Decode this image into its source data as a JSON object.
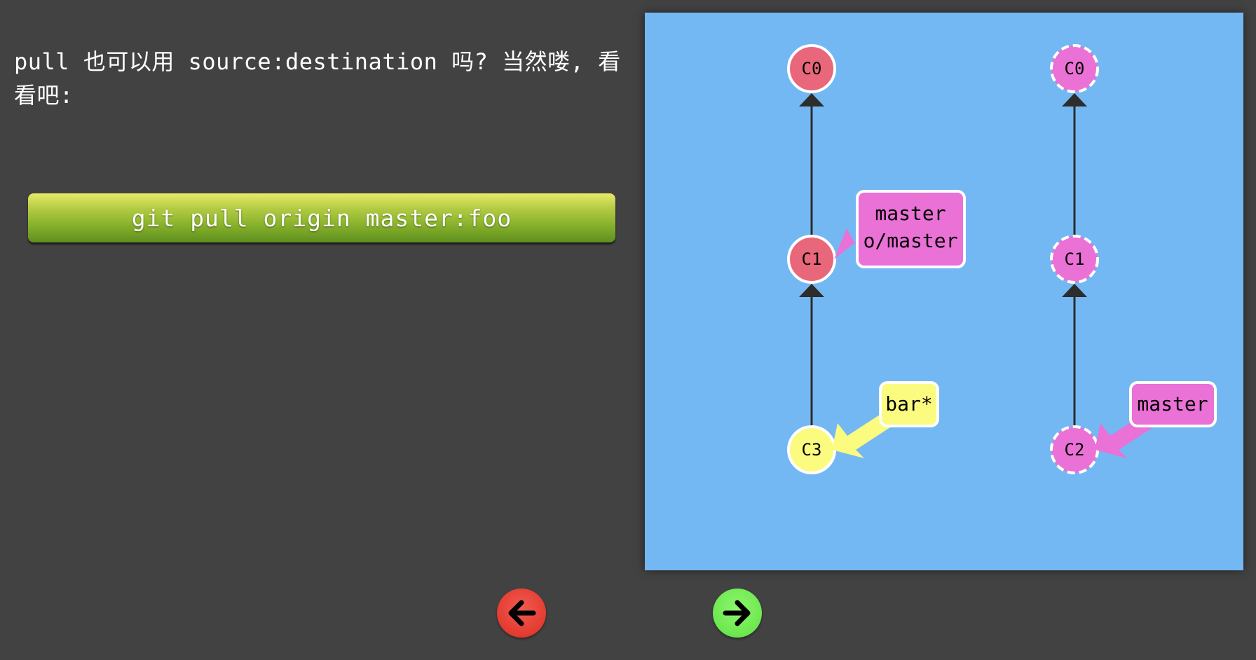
{
  "intro": {
    "text": "pull 也可以用 source:destination 吗? 当然喽, 看看吧:"
  },
  "command": {
    "label": "git pull origin master:foo"
  },
  "colors": {
    "background": "#424242",
    "viz_background": "#74b8f3",
    "commit_red": "#e8677a",
    "commit_yellow": "#fbfb80",
    "commit_pink": "#ea71d5",
    "branch_pink": "#ea71d5",
    "branch_yellow": "#fbfb80",
    "edge": "#2d2d2d",
    "nav_prev": "#e33b30",
    "nav_next": "#6ce84e"
  },
  "local_repo": {
    "commits": [
      {
        "id": "C0",
        "color": "commit_red"
      },
      {
        "id": "C1",
        "color": "commit_red"
      },
      {
        "id": "C3",
        "color": "commit_yellow"
      }
    ],
    "branches": [
      {
        "lines": [
          "master",
          "o/master"
        ],
        "target": "C1",
        "color": "branch_pink"
      },
      {
        "lines": [
          "bar*"
        ],
        "target": "C3",
        "color": "branch_yellow"
      }
    ]
  },
  "remote_repo": {
    "commits": [
      {
        "id": "C0",
        "color": "commit_pink",
        "dashed": true
      },
      {
        "id": "C1",
        "color": "commit_pink",
        "dashed": true
      },
      {
        "id": "C2",
        "color": "commit_pink",
        "dashed": true
      }
    ],
    "branches": [
      {
        "lines": [
          "master"
        ],
        "target": "C2",
        "color": "branch_pink"
      }
    ]
  },
  "navigation": {
    "prev_icon": "arrow-left-icon",
    "next_icon": "arrow-right-icon"
  }
}
